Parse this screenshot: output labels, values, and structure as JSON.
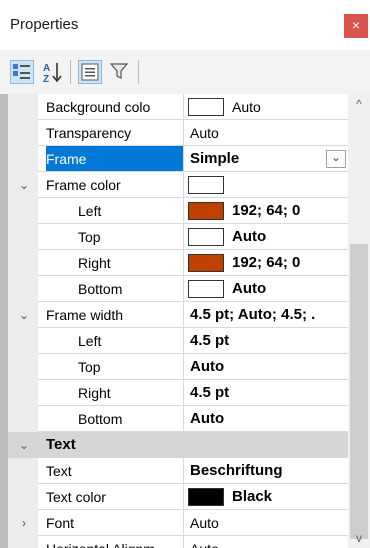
{
  "window": {
    "title": "Properties",
    "close_glyph": "×"
  },
  "toolbar": {
    "buttons": [
      {
        "name": "categorized-icon",
        "active": true
      },
      {
        "name": "alphabetical-sort-icon",
        "glyph": "A Z",
        "active": false
      },
      {
        "name": "property-pages-icon",
        "active": false
      },
      {
        "name": "filter-icon",
        "active": false
      }
    ]
  },
  "properties": [
    {
      "label": "Background colo",
      "value": "Auto",
      "swatch": "#ffffff",
      "indent": false,
      "bold": false
    },
    {
      "label": "Transparency",
      "value": "Auto",
      "indent": false,
      "bold": false
    },
    {
      "label": "Frame",
      "value": "Simple",
      "indent": false,
      "bold": true,
      "selected": true
    },
    {
      "label": "Frame color",
      "value": "",
      "swatch": "#ffffff",
      "indent": false,
      "expanded": true
    },
    {
      "label": "Left",
      "value": "192; 64; 0",
      "swatch": "#c04000",
      "indent": true,
      "bold": true
    },
    {
      "label": "Top",
      "value": "Auto",
      "swatch": "#ffffff",
      "indent": true,
      "bold": true
    },
    {
      "label": "Right",
      "value": "192; 64; 0",
      "swatch": "#c04000",
      "indent": true,
      "bold": true
    },
    {
      "label": "Bottom",
      "value": "Auto",
      "swatch": "#ffffff",
      "indent": true,
      "bold": true
    },
    {
      "label": "Frame width",
      "value": "4.5 pt; Auto; 4.5; .",
      "indent": false,
      "bold": true,
      "expanded": true
    },
    {
      "label": "Left",
      "value": "4.5 pt",
      "indent": true,
      "bold": true
    },
    {
      "label": "Top",
      "value": "Auto",
      "indent": true,
      "bold": true
    },
    {
      "label": "Right",
      "value": "4.5 pt",
      "indent": true,
      "bold": true
    },
    {
      "label": "Bottom",
      "value": "Auto",
      "indent": true,
      "bold": true
    }
  ],
  "category": {
    "label": "Text"
  },
  "text_properties": [
    {
      "label": "Text",
      "value": "Beschriftung",
      "bold": true
    },
    {
      "label": "Text color",
      "value": "Black",
      "swatch": "#000000",
      "bold": true
    },
    {
      "label": "Font",
      "value": "Auto",
      "bold": false,
      "collapsed": true
    },
    {
      "label": "Horizontal Alignm",
      "value": "Auto",
      "bold": false
    }
  ],
  "scroll_glyphs": {
    "up": "^",
    "down": "v"
  },
  "colors": {
    "selection": "#0078d7",
    "accent_close": "#d9534f",
    "orange_swatch": "#c04000"
  }
}
